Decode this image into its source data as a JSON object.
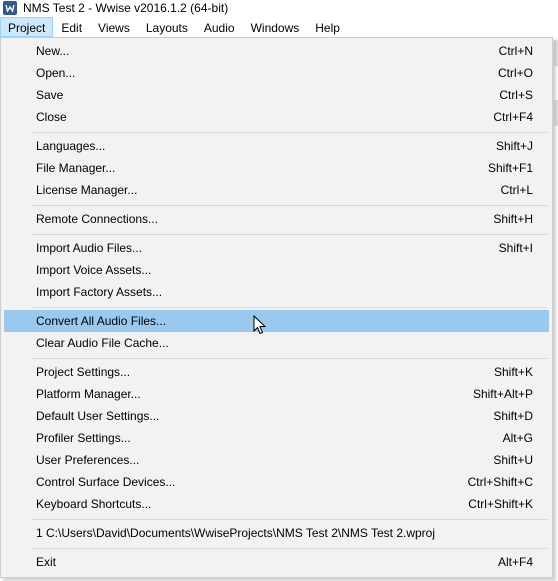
{
  "window": {
    "title": "NMS Test 2 - Wwise v2016.1.2 (64-bit)",
    "icon": "wwise-logo-icon"
  },
  "menubar": {
    "items": [
      "Project",
      "Edit",
      "Views",
      "Layouts",
      "Audio",
      "Windows",
      "Help"
    ],
    "active": "Project"
  },
  "colors": {
    "menu_background": "#f2f2f2",
    "highlight": "#99c9ef",
    "active_menubar": "#cce8ff",
    "separator": "#d7d7d7"
  },
  "menu": {
    "new": {
      "label": "New...",
      "shortcut": "Ctrl+N"
    },
    "open": {
      "label": "Open...",
      "shortcut": "Ctrl+O"
    },
    "save": {
      "label": "Save",
      "shortcut": "Ctrl+S"
    },
    "close": {
      "label": "Close",
      "shortcut": "Ctrl+F4"
    },
    "languages": {
      "label": "Languages...",
      "shortcut": "Shift+J"
    },
    "file_manager": {
      "label": "File Manager...",
      "shortcut": "Shift+F1"
    },
    "license_manager": {
      "label": "License Manager...",
      "shortcut": "Ctrl+L"
    },
    "remote_connections": {
      "label": "Remote Connections...",
      "shortcut": "Shift+H"
    },
    "import_audio": {
      "label": "Import Audio Files...",
      "shortcut": "Shift+I"
    },
    "import_voice": {
      "label": "Import Voice Assets...",
      "shortcut": ""
    },
    "import_factory": {
      "label": "Import Factory Assets...",
      "shortcut": ""
    },
    "convert_all": {
      "label": "Convert All Audio Files...",
      "shortcut": ""
    },
    "clear_cache": {
      "label": "Clear Audio File Cache...",
      "shortcut": ""
    },
    "project_settings": {
      "label": "Project Settings...",
      "shortcut": "Shift+K"
    },
    "platform_manager": {
      "label": "Platform Manager...",
      "shortcut": "Shift+Alt+P"
    },
    "default_user_settings": {
      "label": "Default User Settings...",
      "shortcut": "Shift+D"
    },
    "profiler_settings": {
      "label": "Profiler Settings...",
      "shortcut": "Alt+G"
    },
    "user_preferences": {
      "label": "User Preferences...",
      "shortcut": "Shift+U"
    },
    "control_surface": {
      "label": "Control Surface Devices...",
      "shortcut": "Ctrl+Shift+C"
    },
    "keyboard_shortcuts": {
      "label": "Keyboard Shortcuts...",
      "shortcut": "Ctrl+Shift+K"
    },
    "recent_1": {
      "label": "1 C:\\Users\\David\\Documents\\WwiseProjects\\NMS Test 2\\NMS Test 2.wproj",
      "shortcut": ""
    },
    "exit": {
      "label": "Exit",
      "shortcut": "Alt+F4"
    }
  },
  "highlighted_item": "Convert All Audio Files..."
}
